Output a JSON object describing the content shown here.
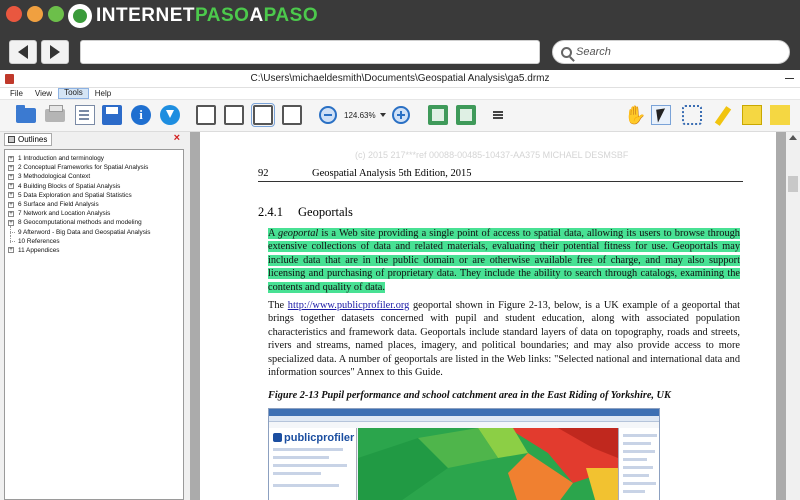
{
  "browser": {
    "logo_text_a": "INTERNET",
    "logo_text_b": "PASO",
    "logo_text_c": "A",
    "logo_text_d": "PASO",
    "search_placeholder": "Search"
  },
  "window": {
    "title": "C:\\Users\\michaeldesmith\\Documents\\Geospatial Analysis\\ga5.drmz"
  },
  "menu": [
    "File",
    "View",
    "Tools",
    "Help"
  ],
  "toolbar": {
    "zoom": "124.63%"
  },
  "sidebar": {
    "tab_label": "Outlines",
    "items": [
      {
        "label": "1 Introduction and terminology",
        "expandable": true
      },
      {
        "label": "2 Conceptual Frameworks for Spatial Analysis",
        "expandable": true
      },
      {
        "label": "3 Methodological Context",
        "expandable": true
      },
      {
        "label": "4 Building Blocks of Spatial Analysis",
        "expandable": true
      },
      {
        "label": "5 Data Exploration and Spatial Statistics",
        "expandable": true
      },
      {
        "label": "6 Surface and Field Analysis",
        "expandable": true
      },
      {
        "label": "7 Network and Location Analysis",
        "expandable": true
      },
      {
        "label": "8 Geocomputational methods and modeling",
        "expandable": true
      },
      {
        "label": "9 Afterword - Big Data and Geospatial Analysis",
        "expandable": false
      },
      {
        "label": "10 References",
        "expandable": false
      },
      {
        "label": "11 Appendices",
        "expandable": true
      }
    ]
  },
  "document": {
    "watermark": "(c) 2015 217***ref 00088-00485-10437-AA375 MICHAEL DESMSBF",
    "page_number": "92",
    "running_title": "Geospatial Analysis 5th Edition, 2015",
    "section_number": "2.4.1",
    "section_title": "Geoportals",
    "p1_a": "A ",
    "p1_em": "geoportal",
    "p1_b": " is a Web site providing a single point of access to spatial data, allowing its users to browse through extensive collections of data and related materials, evaluating their potential fitness for use. Geoportals may include data that are in the public domain or are otherwise available free of charge, and may also support licensing and purchasing of proprietary data. They include the ability to search through catalogs, examining the contents and quality of data.",
    "p2_a": "The ",
    "p2_link": "http://www.publicprofiler.org",
    "p2_b": " geoportal shown in Figure 2-13, below, is a UK example of a geoportal that brings together datasets concerned with pupil and student education, along with associated population characteristics and framework data. Geoportals include standard layers of data on topography, roads and streets, rivers and streams, named places, imagery, and political boundaries; and may also provide access to more specialized data. A number of geoportals are listed in the Web links: \"Selected national and international data and information sources\" Annex to this Guide.",
    "figure_caption": "Figure 2-13 Pupil performance and school catchment area in the East Riding of Yorkshire, UK",
    "figure_logo": "publicprofiler"
  },
  "colors": {
    "highlight": "#48e194",
    "link": "#1a1aa6",
    "close": "#d21f1f"
  }
}
